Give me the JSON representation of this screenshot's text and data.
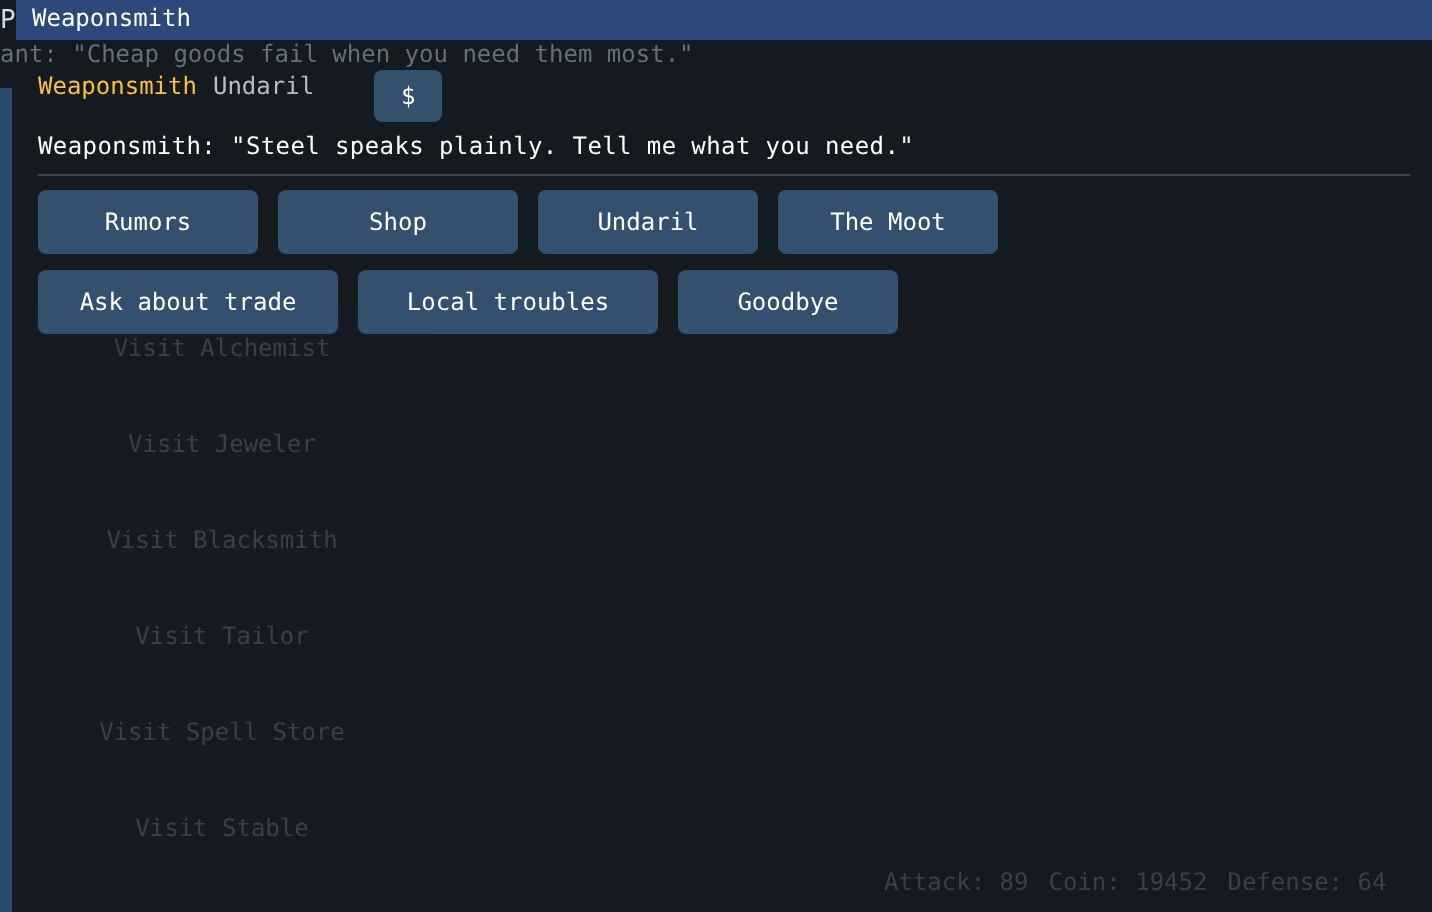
{
  "background": {
    "corner_letter": "P",
    "quote": "ant: \"Cheap goods fail when you need them most.\"",
    "visit_buttons": [
      "Visit Alchemist",
      "Visit Jeweler",
      "Visit Blacksmith",
      "Visit Tailor",
      "Visit Spell Store",
      "Visit Stable"
    ],
    "stats": [
      "Attack: 89",
      "Coin: 19452",
      "Defense: 64"
    ]
  },
  "window": {
    "title": "Weaponsmith",
    "npc_name": "Weaponsmith",
    "location": "Undaril",
    "shop_button": "$",
    "dialogue": "Weaponsmith: \"Steel speaks plainly. Tell me what you need.\"",
    "topic_rows": [
      [
        "Rumors",
        "Shop",
        "Undaril",
        "The Moot"
      ],
      [
        "Ask about trade",
        "Local troubles",
        "Goodbye"
      ]
    ]
  }
}
